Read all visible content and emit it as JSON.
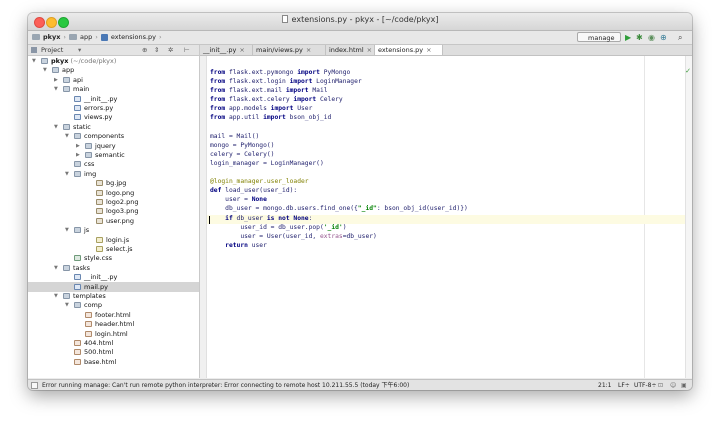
{
  "window": {
    "title": "extensions.py - pkyx - [~/code/pkyx]"
  },
  "navbar": {
    "crumbs": [
      "pkyx",
      "app",
      "extensions.py"
    ],
    "run_config": "manage"
  },
  "project_panel": {
    "header": "Project",
    "tree": [
      {
        "label": "pkyx",
        "hint": "(~/code/pkyx)",
        "depth": 0,
        "kind": "folder",
        "expanded": true
      },
      {
        "label": "app",
        "depth": 1,
        "kind": "folder",
        "expanded": true
      },
      {
        "label": "api",
        "depth": 2,
        "kind": "folder",
        "expanded": false
      },
      {
        "label": "main",
        "depth": 2,
        "kind": "folder",
        "expanded": true
      },
      {
        "label": "__init__.py",
        "depth": 3,
        "kind": "py"
      },
      {
        "label": "errors.py",
        "depth": 3,
        "kind": "py"
      },
      {
        "label": "views.py",
        "depth": 3,
        "kind": "py"
      },
      {
        "label": "static",
        "depth": 2,
        "kind": "folder",
        "expanded": true
      },
      {
        "label": "components",
        "depth": 3,
        "kind": "folder",
        "expanded": true
      },
      {
        "label": "jquery",
        "depth": 4,
        "kind": "folder",
        "expanded": false
      },
      {
        "label": "semantic",
        "depth": 4,
        "kind": "folder",
        "expanded": false
      },
      {
        "label": "css",
        "depth": 3,
        "kind": "folder"
      },
      {
        "label": "img",
        "depth": 3,
        "kind": "folder",
        "expanded": true
      },
      {
        "label": "bg.jpg",
        "depth": 5,
        "kind": "img"
      },
      {
        "label": "logo.png",
        "depth": 5,
        "kind": "img"
      },
      {
        "label": "logo2.png",
        "depth": 5,
        "kind": "img"
      },
      {
        "label": "logo3.png",
        "depth": 5,
        "kind": "img"
      },
      {
        "label": "user.png",
        "depth": 5,
        "kind": "img"
      },
      {
        "label": "js",
        "depth": 3,
        "kind": "folder",
        "expanded": true
      },
      {
        "label": "login.js",
        "depth": 5,
        "kind": "js"
      },
      {
        "label": "select.js",
        "depth": 5,
        "kind": "js"
      },
      {
        "label": "style.css",
        "depth": 3,
        "kind": "css"
      },
      {
        "label": "tasks",
        "depth": 2,
        "kind": "folder",
        "expanded": true
      },
      {
        "label": "__init__.py",
        "depth": 3,
        "kind": "py"
      },
      {
        "label": "mail.py",
        "depth": 3,
        "kind": "py",
        "selected": true
      },
      {
        "label": "templates",
        "depth": 2,
        "kind": "folder",
        "expanded": true
      },
      {
        "label": "comp",
        "depth": 3,
        "kind": "folder",
        "expanded": true
      },
      {
        "label": "footer.html",
        "depth": 4,
        "kind": "html"
      },
      {
        "label": "header.html",
        "depth": 4,
        "kind": "html"
      },
      {
        "label": "login.html",
        "depth": 4,
        "kind": "html"
      },
      {
        "label": "404.html",
        "depth": 3,
        "kind": "html"
      },
      {
        "label": "500.html",
        "depth": 3,
        "kind": "html"
      },
      {
        "label": "base.html",
        "depth": 3,
        "kind": "html"
      }
    ]
  },
  "tabs": [
    {
      "label": "__init__.py",
      "active": false
    },
    {
      "label": "main/views.py",
      "active": false
    },
    {
      "label": "index.html",
      "active": false
    },
    {
      "label": "extensions.py",
      "active": true
    }
  ],
  "editor": {
    "lines": [
      [
        [
          "kw",
          "from"
        ],
        [
          "t",
          " flask.ext.pymongo "
        ],
        [
          "kw",
          "import"
        ],
        [
          "t",
          " PyMongo"
        ]
      ],
      [
        [
          "kw",
          "from"
        ],
        [
          "t",
          " flask.ext.login "
        ],
        [
          "kw",
          "import"
        ],
        [
          "t",
          " LoginManager"
        ]
      ],
      [
        [
          "kw",
          "from"
        ],
        [
          "t",
          " flask.ext.mail "
        ],
        [
          "kw",
          "import"
        ],
        [
          "t",
          " Mail"
        ]
      ],
      [
        [
          "kw",
          "from"
        ],
        [
          "t",
          " flask.ext.celery "
        ],
        [
          "kw",
          "import"
        ],
        [
          "t",
          " Celery"
        ]
      ],
      [
        [
          "kw",
          "from"
        ],
        [
          "t",
          " app.models "
        ],
        [
          "kw",
          "import"
        ],
        [
          "t",
          " User"
        ]
      ],
      [
        [
          "kw",
          "from"
        ],
        [
          "t",
          " app.util "
        ],
        [
          "kw",
          "import"
        ],
        [
          "t",
          " bson_obj_id"
        ]
      ],
      [],
      [
        [
          "t",
          "mail = Mail()"
        ]
      ],
      [
        [
          "t",
          "mongo = PyMongo()"
        ]
      ],
      [
        [
          "t",
          "celery = Celery()"
        ]
      ],
      [
        [
          "t",
          "login_manager = LoginManager()"
        ]
      ],
      [],
      [
        [
          "dec",
          "@login_manager.user_loader"
        ]
      ],
      [
        [
          "kw",
          "def"
        ],
        [
          "t",
          " load_user(user_id):"
        ]
      ],
      [
        [
          "t",
          "    user = "
        ],
        [
          "kw",
          "None"
        ]
      ],
      [
        [
          "t",
          "    db_user = mongo.db.users.find_one({"
        ],
        [
          "str",
          "\"_id\""
        ],
        [
          "t",
          ": bson_obj_id(user_id)})"
        ]
      ],
      [
        [
          "t",
          "    "
        ],
        [
          "kw",
          "if"
        ],
        [
          "t",
          " db_user "
        ],
        [
          "kw",
          "is not None"
        ],
        [
          "t",
          ":"
        ]
      ],
      [
        [
          "t",
          "        user_id = db_user.pop("
        ],
        [
          "str",
          "'_id'"
        ],
        [
          "t",
          ")"
        ]
      ],
      [
        [
          "t",
          "        user = User(user_id, "
        ],
        [
          "param",
          "extras"
        ],
        [
          "t",
          "=db_user)"
        ]
      ],
      [
        [
          "t",
          "    "
        ],
        [
          "kw",
          "return"
        ],
        [
          "t",
          " user"
        ]
      ]
    ]
  },
  "status": {
    "message": "Error running manage: Can't run remote python interpreter: Error connecting to remote host 10.211.55.5 (today 下午6:00)",
    "position": "21:1",
    "line_sep": "LF÷",
    "encoding": "UTF-8÷"
  },
  "colors": {
    "keyword": "#000080",
    "string": "#008000",
    "decorator": "#808000",
    "selection": "#d5d5d5"
  }
}
